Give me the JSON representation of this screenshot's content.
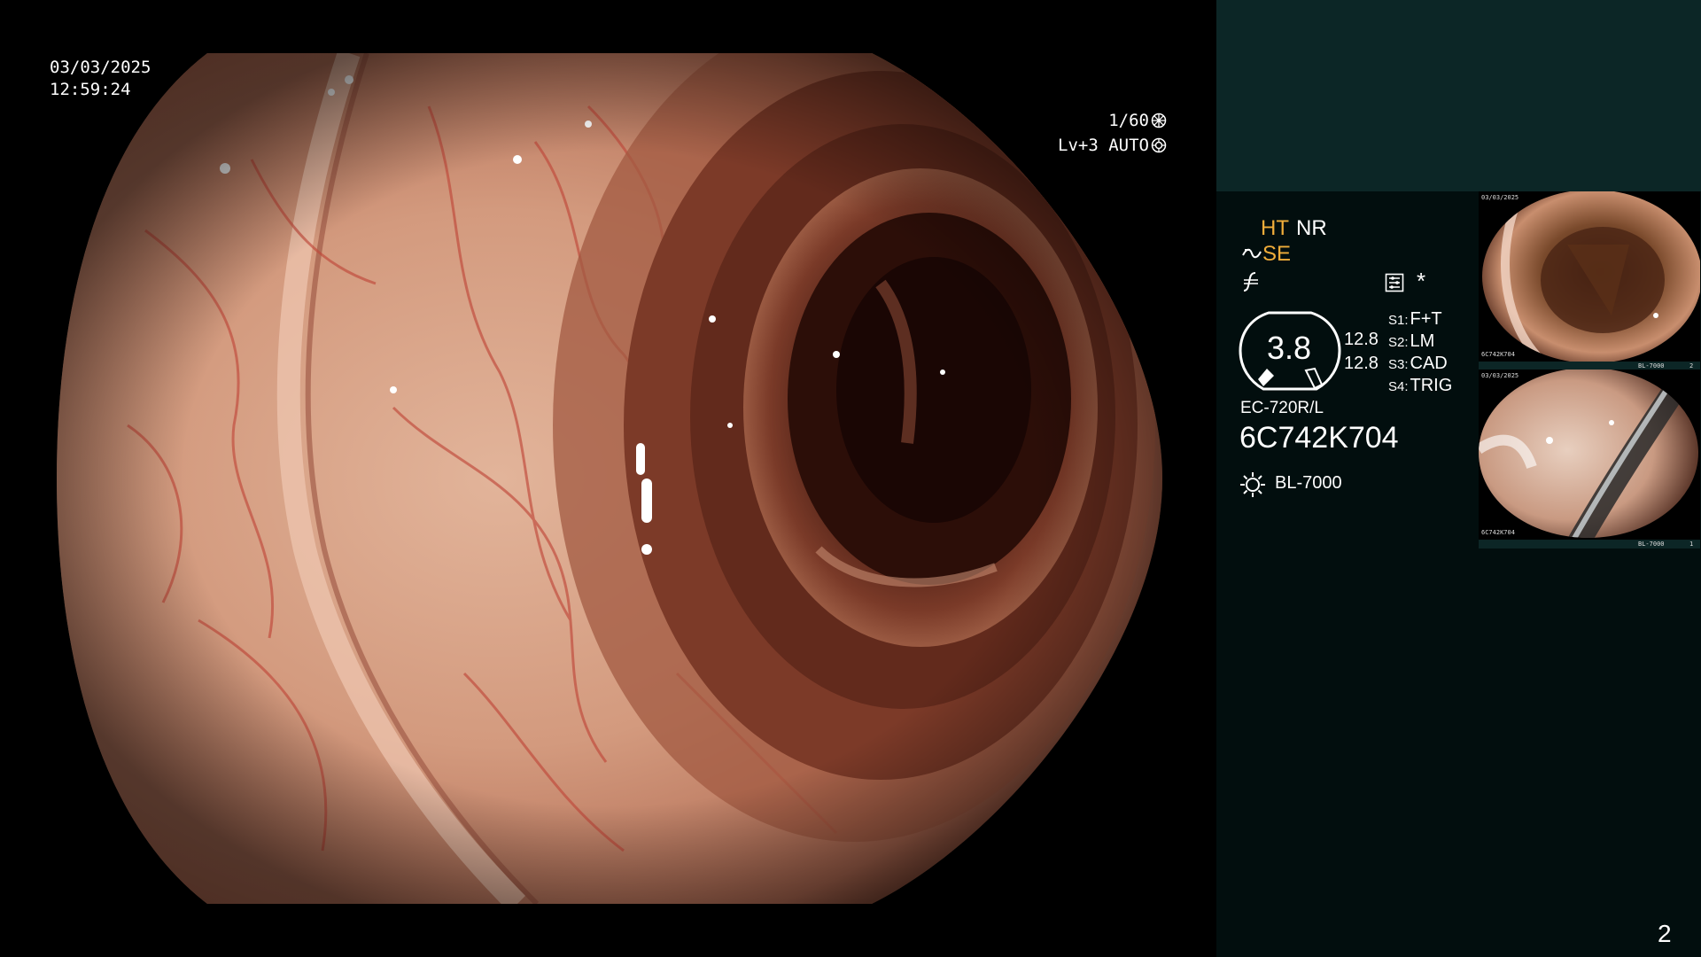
{
  "osd": {
    "date": "03/03/2025",
    "time": "12:59:24",
    "shutter": "1/60",
    "level": "Lv+3 AUTO",
    "shutter_icon": "aperture-icon",
    "level_icon": "auto-iris-icon"
  },
  "panel": {
    "modes": {
      "ht": "HT",
      "nr": "NR",
      "se": "SE",
      "se_icon": "enhance-icon",
      "f_icon": "filter-icon"
    },
    "settings_icon": "settings-icon",
    "asterisk": "*",
    "gauge": {
      "value": "3.8",
      "sub1": "12.8",
      "sub2": "12.8",
      "icon": "hood-gauge-icon"
    },
    "switches": [
      {
        "key": "S1:",
        "value": "F+T"
      },
      {
        "key": "S2:",
        "value": "LM"
      },
      {
        "key": "S3:",
        "value": "CAD"
      },
      {
        "key": "S4:",
        "value": "TRIG"
      }
    ],
    "scope_model": "EC-720R/L",
    "scope_serial": "6C742K704",
    "light_source": "BL-7000",
    "light_icon": "sun-icon",
    "page_number": "2"
  },
  "thumbnails": [
    {
      "date": "03/03/2025",
      "serial": "6C742K704",
      "source": "BL-7000",
      "index": "2"
    },
    {
      "date": "03/03/2025",
      "serial": "6C742K704",
      "source": "BL-7000",
      "index": "1"
    }
  ],
  "colors": {
    "accent_orange": "#f0ad3a",
    "panel_bg": "#020e0e",
    "panel_header": "#0c2626"
  }
}
